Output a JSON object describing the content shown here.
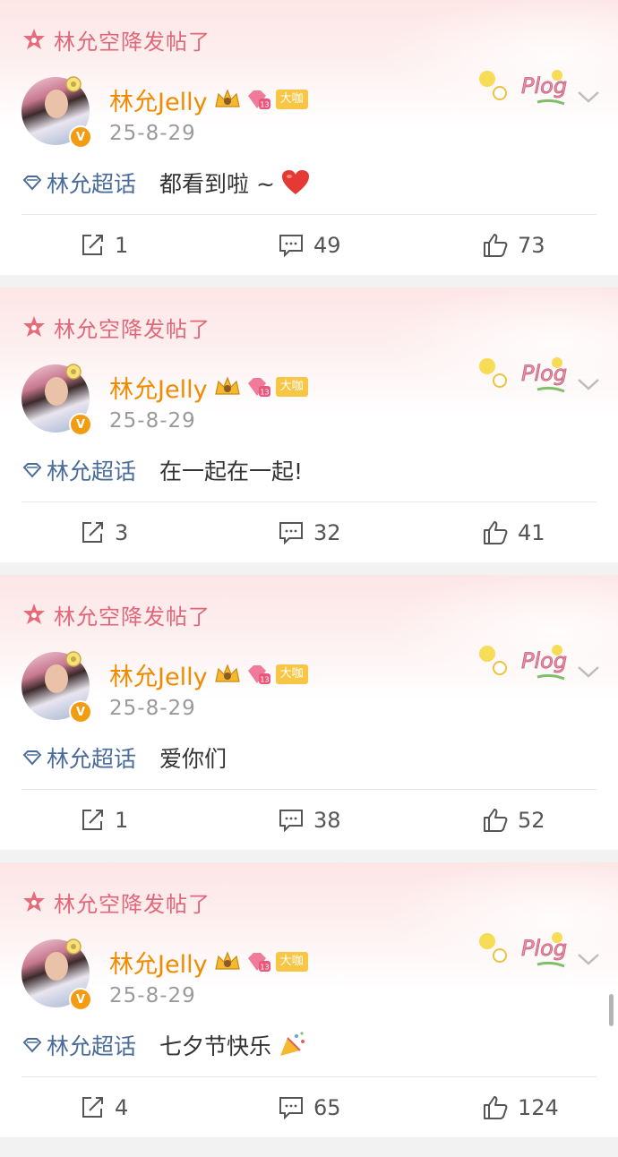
{
  "posts": [
    {
      "banner": "林允空降发帖了",
      "username": "林允Jelly",
      "vip": "大咖",
      "date": "25-8-29",
      "topic": "林允超话",
      "text": "都看到啦 ~",
      "emoji": "heart",
      "repost": "1",
      "comment": "49",
      "like": "73"
    },
    {
      "banner": "林允空降发帖了",
      "username": "林允Jelly",
      "vip": "大咖",
      "date": "25-8-29",
      "topic": "林允超话",
      "text": "在一起在一起!",
      "emoji": "",
      "repost": "3",
      "comment": "32",
      "like": "41"
    },
    {
      "banner": "林允空降发帖了",
      "username": "林允Jelly",
      "vip": "大咖",
      "date": "25-8-29",
      "topic": "林允超话",
      "text": "爱你们",
      "emoji": "",
      "repost": "1",
      "comment": "38",
      "like": "52"
    },
    {
      "banner": "林允空降发帖了",
      "username": "林允Jelly",
      "vip": "大咖",
      "date": "25-8-29",
      "topic": "林允超话",
      "text": "七夕节快乐",
      "emoji": "party",
      "repost": "4",
      "comment": "65",
      "like": "124"
    }
  ],
  "colors": {
    "banner": "#e0677a",
    "username": "#f08a00",
    "topic": "#4a6c9a",
    "vip": "#f6c644"
  },
  "icons": [
    "star-badge-icon",
    "crown-icon",
    "level-icon",
    "verified-icon",
    "plog-sticker-icon",
    "chevron-down-icon",
    "topic-diamond-icon",
    "repost-icon",
    "comment-icon",
    "like-icon"
  ]
}
